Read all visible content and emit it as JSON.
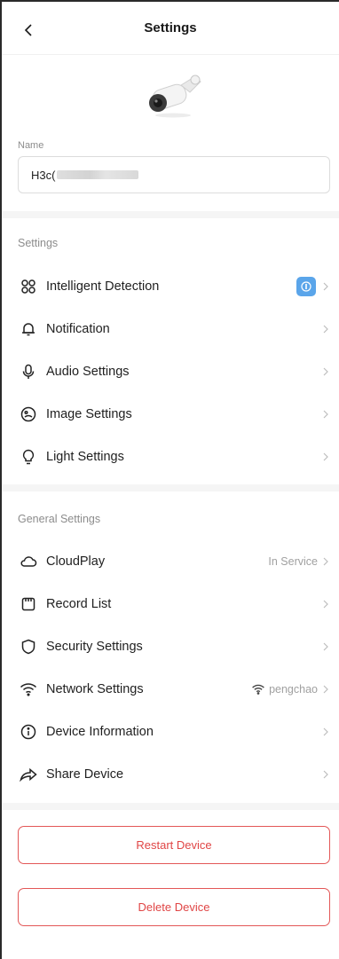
{
  "header": {
    "title": "Settings"
  },
  "device": {
    "name_label": "Name",
    "name_value": "H3c("
  },
  "settings_section": {
    "title": "Settings",
    "items": [
      {
        "label": "Intelligent Detection",
        "icon": "detection-icon",
        "right": ""
      },
      {
        "label": "Notification",
        "icon": "bell-icon",
        "right": ""
      },
      {
        "label": "Audio Settings",
        "icon": "microphone-icon",
        "right": ""
      },
      {
        "label": "Image Settings",
        "icon": "image-icon",
        "right": ""
      },
      {
        "label": "Light Settings",
        "icon": "lightbulb-icon",
        "right": ""
      }
    ]
  },
  "general_section": {
    "title": "General Settings",
    "items": [
      {
        "label": "CloudPlay",
        "icon": "cloud-icon",
        "right": "In Service"
      },
      {
        "label": "Record List",
        "icon": "sd-card-icon",
        "right": ""
      },
      {
        "label": "Security Settings",
        "icon": "shield-icon",
        "right": ""
      },
      {
        "label": "Network Settings",
        "icon": "wifi-icon",
        "right": "pengchao"
      },
      {
        "label": "Device Information",
        "icon": "info-icon",
        "right": ""
      },
      {
        "label": "Share Device",
        "icon": "share-icon",
        "right": ""
      }
    ]
  },
  "buttons": {
    "restart": "Restart Device",
    "delete": "Delete Device"
  },
  "colors": {
    "accent_red": "#e04545",
    "badge_blue": "#5aa5ea",
    "muted": "#8c8c8c"
  }
}
